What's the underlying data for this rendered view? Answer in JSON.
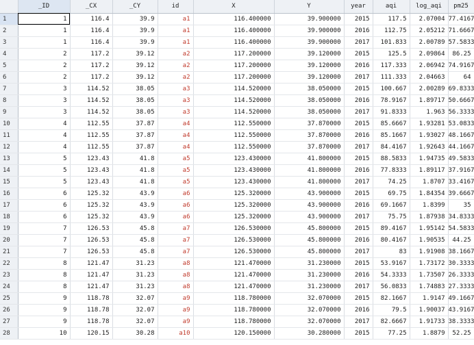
{
  "columns": [
    "",
    "_ID",
    "_CX",
    "_CY",
    "id",
    "X",
    "Y",
    "year",
    "aqi",
    "log_aqi",
    "pm25"
  ],
  "rows": [
    [
      "1",
      "1",
      "116.4",
      "39.9",
      "a1",
      "116.400000",
      "39.900000",
      "2015",
      "117.5",
      "2.07004",
      "77.4167"
    ],
    [
      "2",
      "1",
      "116.4",
      "39.9",
      "a1",
      "116.400000",
      "39.900000",
      "2016",
      "112.75",
      "2.05212",
      "71.6667"
    ],
    [
      "3",
      "1",
      "116.4",
      "39.9",
      "a1",
      "116.400000",
      "39.900000",
      "2017",
      "101.833",
      "2.00789",
      "57.5833"
    ],
    [
      "4",
      "2",
      "117.2",
      "39.12",
      "a2",
      "117.200000",
      "39.120000",
      "2015",
      "125.5",
      "2.09864",
      "86.25"
    ],
    [
      "5",
      "2",
      "117.2",
      "39.12",
      "a2",
      "117.200000",
      "39.120000",
      "2016",
      "117.333",
      "2.06942",
      "74.9167"
    ],
    [
      "6",
      "2",
      "117.2",
      "39.12",
      "a2",
      "117.200000",
      "39.120000",
      "2017",
      "111.333",
      "2.04663",
      "64"
    ],
    [
      "7",
      "3",
      "114.52",
      "38.05",
      "a3",
      "114.520000",
      "38.050000",
      "2015",
      "100.667",
      "2.00289",
      "69.8333"
    ],
    [
      "8",
      "3",
      "114.52",
      "38.05",
      "a3",
      "114.520000",
      "38.050000",
      "2016",
      "78.9167",
      "1.89717",
      "50.6667"
    ],
    [
      "9",
      "3",
      "114.52",
      "38.05",
      "a3",
      "114.520000",
      "38.050000",
      "2017",
      "91.8333",
      "1.963",
      "56.3333"
    ],
    [
      "10",
      "4",
      "112.55",
      "37.87",
      "a4",
      "112.550000",
      "37.870000",
      "2015",
      "85.6667",
      "1.93281",
      "53.0833"
    ],
    [
      "11",
      "4",
      "112.55",
      "37.87",
      "a4",
      "112.550000",
      "37.870000",
      "2016",
      "85.1667",
      "1.93027",
      "48.1667"
    ],
    [
      "12",
      "4",
      "112.55",
      "37.87",
      "a4",
      "112.550000",
      "37.870000",
      "2017",
      "84.4167",
      "1.92643",
      "44.1667"
    ],
    [
      "13",
      "5",
      "123.43",
      "41.8",
      "a5",
      "123.430000",
      "41.800000",
      "2015",
      "88.5833",
      "1.94735",
      "49.5833"
    ],
    [
      "14",
      "5",
      "123.43",
      "41.8",
      "a5",
      "123.430000",
      "41.800000",
      "2016",
      "77.8333",
      "1.89117",
      "37.9167"
    ],
    [
      "15",
      "5",
      "123.43",
      "41.8",
      "a5",
      "123.430000",
      "41.800000",
      "2017",
      "74.25",
      "1.8707",
      "33.4167"
    ],
    [
      "16",
      "6",
      "125.32",
      "43.9",
      "a6",
      "125.320000",
      "43.900000",
      "2015",
      "69.75",
      "1.84354",
      "39.6667"
    ],
    [
      "17",
      "6",
      "125.32",
      "43.9",
      "a6",
      "125.320000",
      "43.900000",
      "2016",
      "69.1667",
      "1.8399",
      "35"
    ],
    [
      "18",
      "6",
      "125.32",
      "43.9",
      "a6",
      "125.320000",
      "43.900000",
      "2017",
      "75.75",
      "1.87938",
      "34.8333"
    ],
    [
      "19",
      "7",
      "126.53",
      "45.8",
      "a7",
      "126.530000",
      "45.800000",
      "2015",
      "89.4167",
      "1.95142",
      "54.5833"
    ],
    [
      "20",
      "7",
      "126.53",
      "45.8",
      "a7",
      "126.530000",
      "45.800000",
      "2016",
      "80.4167",
      "1.90535",
      "44.25"
    ],
    [
      "21",
      "7",
      "126.53",
      "45.8",
      "a7",
      "126.530000",
      "45.800000",
      "2017",
      "83",
      "1.91908",
      "38.1667"
    ],
    [
      "22",
      "8",
      "121.47",
      "31.23",
      "a8",
      "121.470000",
      "31.230000",
      "2015",
      "53.9167",
      "1.73172",
      "30.3333"
    ],
    [
      "23",
      "8",
      "121.47",
      "31.23",
      "a8",
      "121.470000",
      "31.230000",
      "2016",
      "54.3333",
      "1.73507",
      "26.3333"
    ],
    [
      "24",
      "8",
      "121.47",
      "31.23",
      "a8",
      "121.470000",
      "31.230000",
      "2017",
      "56.0833",
      "1.74883",
      "27.3333"
    ],
    [
      "25",
      "9",
      "118.78",
      "32.07",
      "a9",
      "118.780000",
      "32.070000",
      "2015",
      "82.1667",
      "1.9147",
      "49.1667"
    ],
    [
      "26",
      "9",
      "118.78",
      "32.07",
      "a9",
      "118.780000",
      "32.070000",
      "2016",
      "79.5",
      "1.90037",
      "43.9167"
    ],
    [
      "27",
      "9",
      "118.78",
      "32.07",
      "a9",
      "118.780000",
      "32.070000",
      "2017",
      "82.6667",
      "1.91733",
      "38.3333"
    ],
    [
      "28",
      "10",
      "120.15",
      "30.28",
      "a10",
      "120.150000",
      "30.280000",
      "2015",
      "77.25",
      "1.8879",
      "52.25"
    ]
  ],
  "colors": {
    "string_text": "#c0392b",
    "header_bg": "#eef1f5"
  }
}
